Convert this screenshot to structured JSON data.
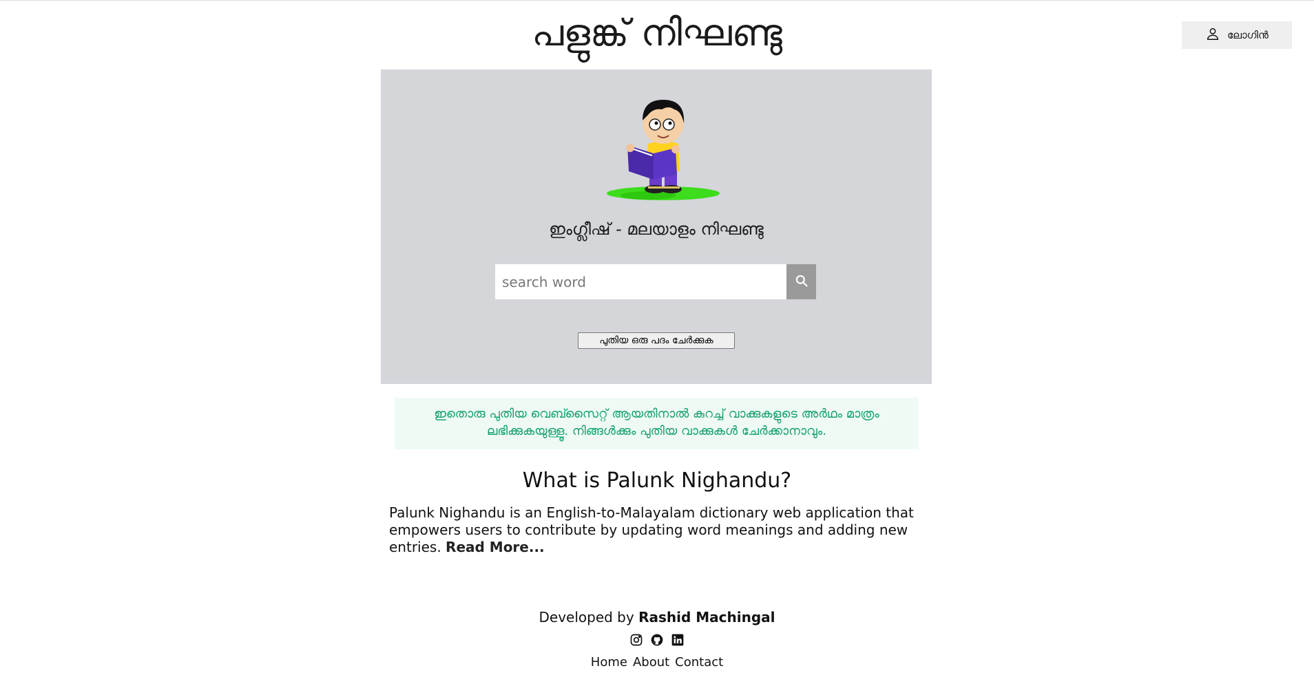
{
  "header": {
    "site_title": "പളുങ്ക് നിഘണ്ടു",
    "login_label": "ലോഗിൻ"
  },
  "hero": {
    "subtitle": "ഇംഗ്ലീഷ് - മലയാളം നിഘണ്ടു",
    "search_placeholder": "search word",
    "add_word_label": "പുതിയ ഒരു പദം ചേർക്കുക"
  },
  "notice": {
    "text": "ഇതൊരു പുതിയ വെബ്സൈറ്റ് ആയതിനാൽ കുറച്ച് വാക്കുകളുടെ അർഥം മാത്രം ലഭിക്കുകയുള്ളൂ. നിങ്ങൾക്കും പുതിയ വാക്കുകൾ ചേർക്കാനാവും."
  },
  "about": {
    "title": "What is Palunk Nighandu?",
    "text": "Palunk Nighandu is an English-to-Malayalam dictionary web application that empowers users to contribute by updating word meanings and adding new entries. ",
    "read_more": "Read More..."
  },
  "footer": {
    "developed_by": "Developed by ",
    "developer_name": "Rashid Machingal",
    "social_icons": [
      "instagram-icon",
      "github-icon",
      "linkedin-icon"
    ],
    "nav": [
      "Home",
      "About",
      "Contact"
    ]
  },
  "colors": {
    "hero_bg": "#d4d6da",
    "notice_bg": "#effaf5",
    "notice_text": "#17a16e",
    "search_button": "#9a9a9a"
  }
}
